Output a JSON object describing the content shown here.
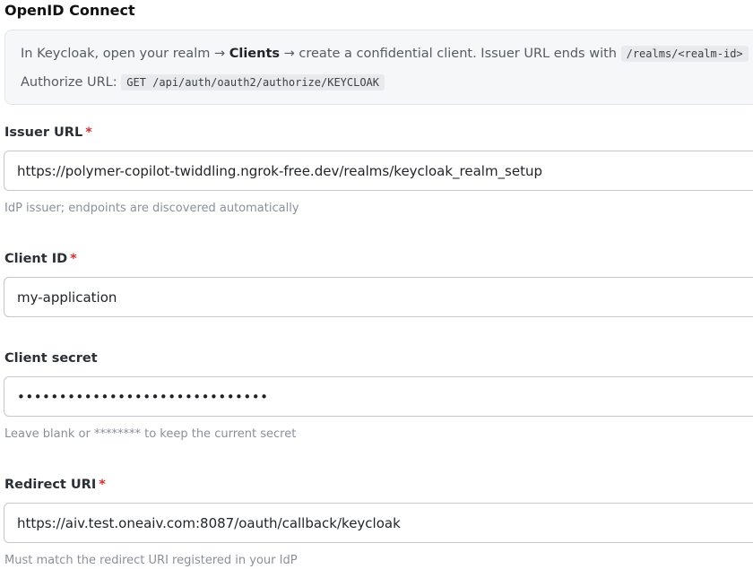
{
  "section": {
    "title": "OpenID Connect"
  },
  "info": {
    "line1": {
      "before": "In Keycloak, open your realm → ",
      "clients": "Clients",
      "after": " → create a confidential client. Issuer URL ends with ",
      "code": "/realms/<realm-id>",
      "tail": " ."
    },
    "line2": {
      "label": "Authorize URL: ",
      "code": "GET /api/auth/oauth2/authorize/KEYCLOAK"
    }
  },
  "fields": {
    "issuer_url": {
      "label": "Issuer URL",
      "required_mark": "*",
      "value": "https://polymer-copilot-twiddling.ngrok-free.dev/realms/keycloak_realm_setup",
      "help": "IdP issuer; endpoints are discovered automatically"
    },
    "client_id": {
      "label": "Client ID",
      "required_mark": "*",
      "value": "my-application"
    },
    "client_secret": {
      "label": "Client secret",
      "value": "dummysecretvalue12345678901234",
      "help": "Leave blank or ******** to keep the current secret"
    },
    "redirect_uri": {
      "label": "Redirect URI",
      "required_mark": "*",
      "value": "https://aiv.test.oneaiv.com:8087/oauth/callback/keycloak",
      "help": "Must match the redirect URI registered in your IdP"
    }
  }
}
